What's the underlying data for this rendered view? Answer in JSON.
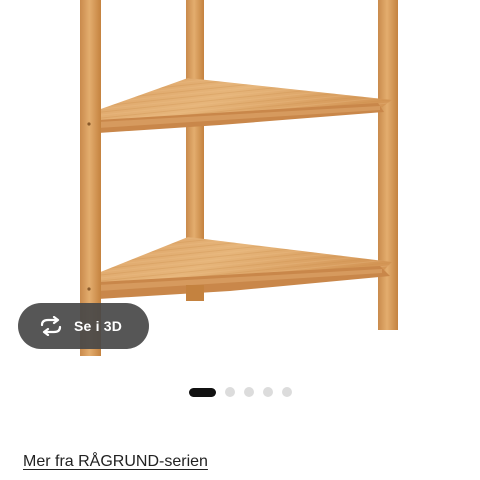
{
  "product_gallery": {
    "image_alt": "Bamboo corner shelf unit",
    "view_3d": {
      "label": "Se i 3D",
      "icon": "rotate-3d-icon"
    },
    "carousel": {
      "total_slides": 5,
      "active_index": 0
    }
  },
  "series_link": {
    "label": "Mer fra RÅGRUND-serien"
  },
  "colors": {
    "bamboo_light": "#e0a869",
    "bamboo_mid": "#cf8f4e",
    "bamboo_dark": "#b8773a",
    "button_bg": "#484848",
    "dot_active": "#111111",
    "dot_inactive": "#dcdcdc"
  }
}
